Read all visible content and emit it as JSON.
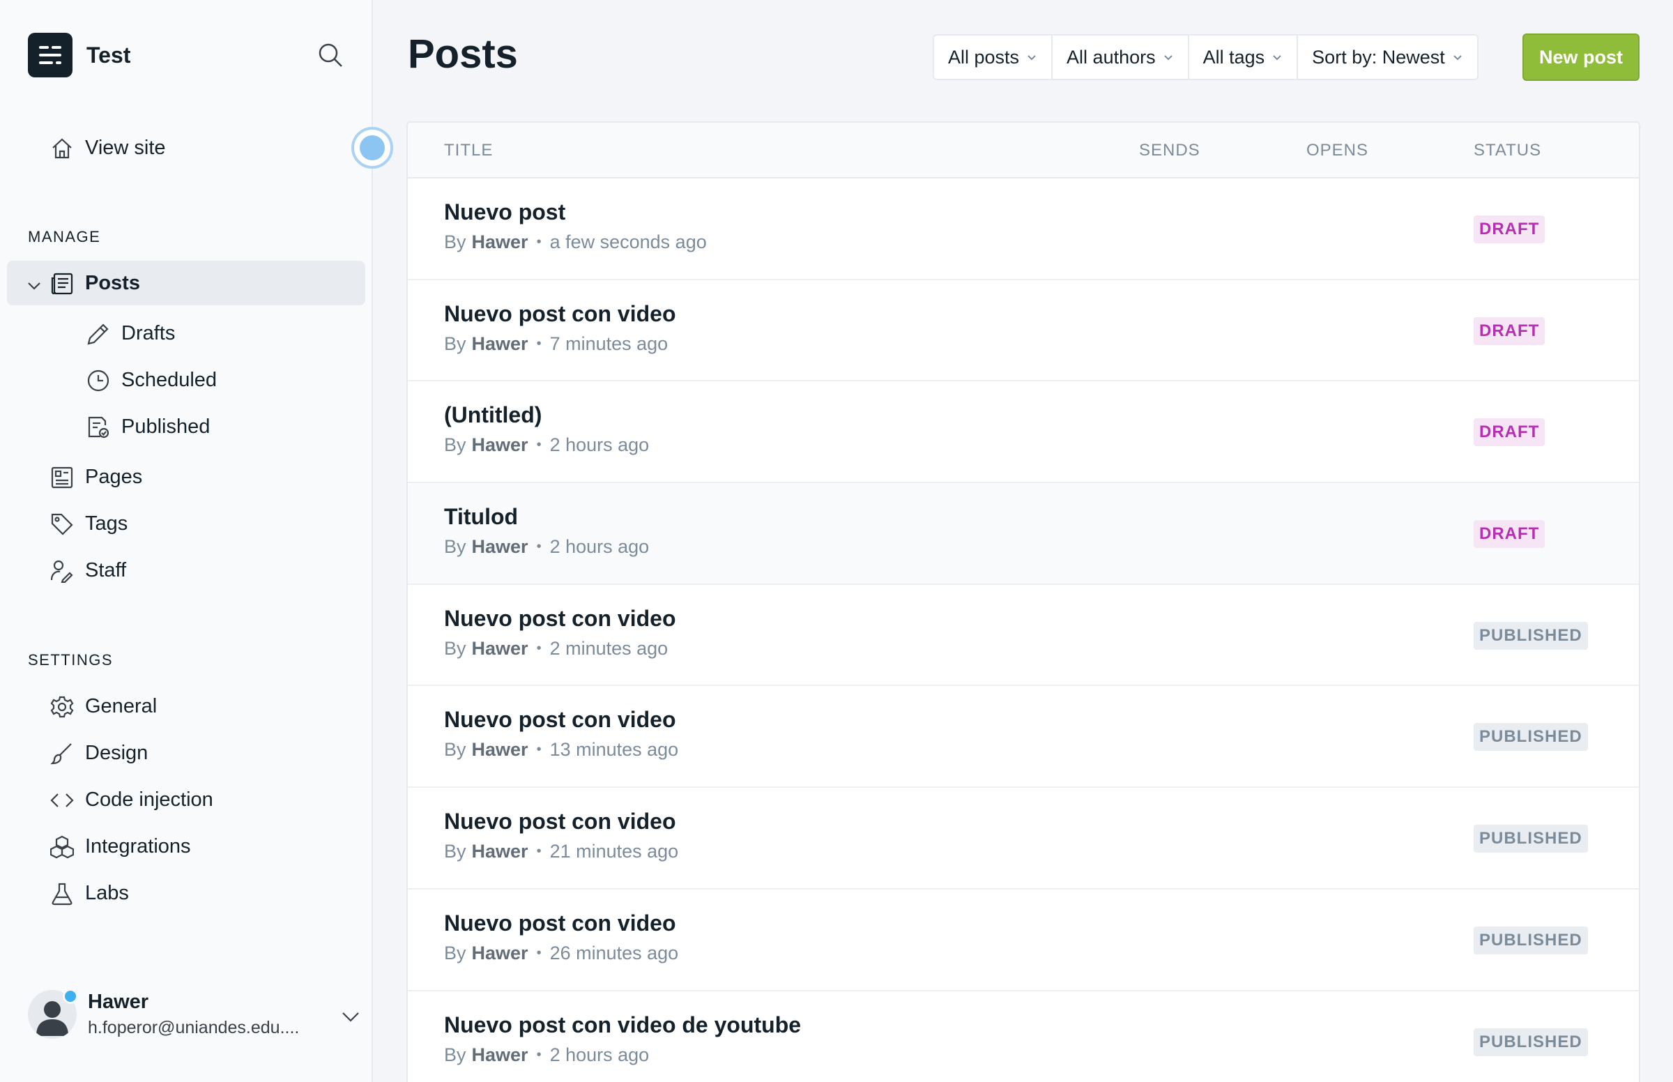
{
  "sidebar": {
    "brand_title": "Test",
    "view_site": "View site",
    "manage_label": "MANAGE",
    "posts": "Posts",
    "drafts": "Drafts",
    "scheduled": "Scheduled",
    "published": "Published",
    "pages": "Pages",
    "tags": "Tags",
    "staff": "Staff",
    "settings_label": "SETTINGS",
    "general": "General",
    "design": "Design",
    "code_injection": "Code injection",
    "integrations": "Integrations",
    "labs": "Labs"
  },
  "user": {
    "name": "Hawer",
    "email": "h.fореror@uniandes.edu...."
  },
  "header": {
    "title": "Posts",
    "filters": [
      "All posts",
      "All authors",
      "All tags",
      "Sort by: Newest"
    ],
    "new_post": "New post"
  },
  "table": {
    "columns": {
      "title": "TITLE",
      "sends": "SENDS",
      "opens": "OPENS",
      "status": "STATUS"
    },
    "by": "By",
    "rows": [
      {
        "title": "Nuevo post",
        "author": "Hawer",
        "time": "a few seconds ago",
        "status": "DRAFT"
      },
      {
        "title": "Nuevo post con video",
        "author": "Hawer",
        "time": "7 minutes ago",
        "status": "DRAFT"
      },
      {
        "title": "(Untitled)",
        "author": "Hawer",
        "time": "2 hours ago",
        "status": "DRAFT"
      },
      {
        "title": "Titulod",
        "author": "Hawer",
        "time": "2 hours ago",
        "status": "DRAFT"
      },
      {
        "title": "Nuevo post con video",
        "author": "Hawer",
        "time": "2 minutes ago",
        "status": "PUBLISHED"
      },
      {
        "title": "Nuevo post con video",
        "author": "Hawer",
        "time": "13 minutes ago",
        "status": "PUBLISHED"
      },
      {
        "title": "Nuevo post con video",
        "author": "Hawer",
        "time": "21 minutes ago",
        "status": "PUBLISHED"
      },
      {
        "title": "Nuevo post con video",
        "author": "Hawer",
        "time": "26 minutes ago",
        "status": "PUBLISHED"
      },
      {
        "title": "Nuevo post con video de youtube",
        "author": "Hawer",
        "time": "2 hours ago",
        "status": "PUBLISHED"
      }
    ]
  },
  "colors": {
    "accent_green": "#8fbd3a",
    "draft_pink": "#b62fb2",
    "online_blue": "#3eb0ef"
  }
}
